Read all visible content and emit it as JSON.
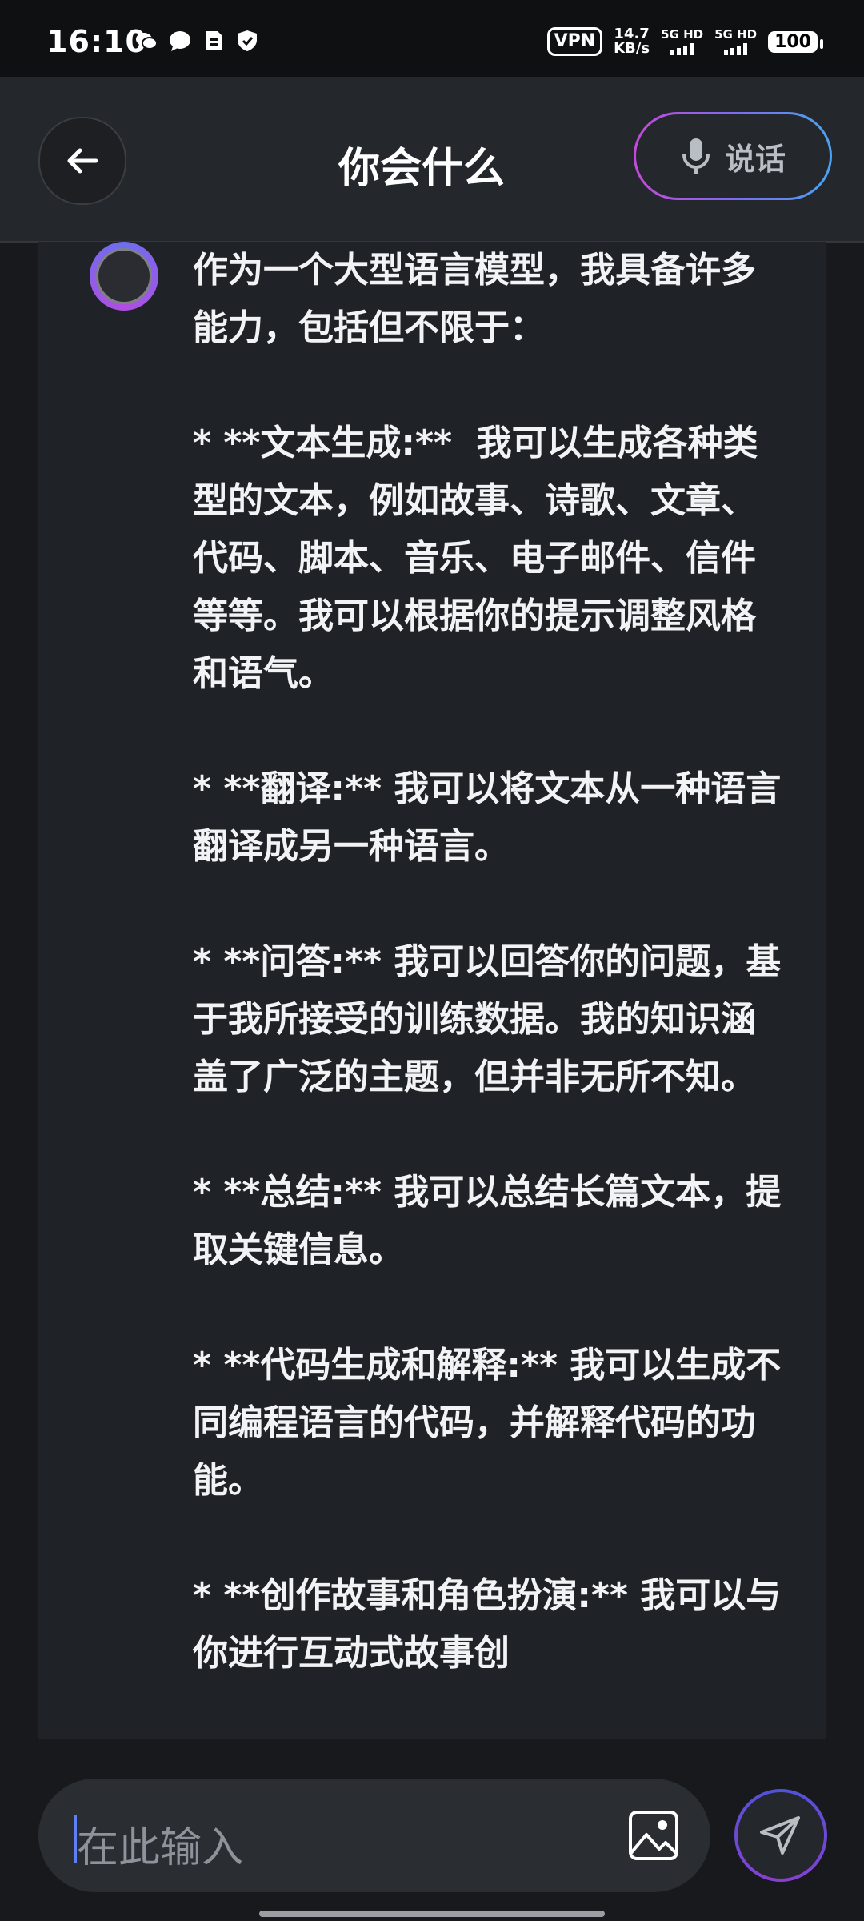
{
  "status_bar": {
    "time": "16:10",
    "icons": [
      "wechat-icon",
      "message-icon",
      "sim-icon",
      "shield-icon"
    ],
    "vpn": "VPN",
    "speed_value": "14.7",
    "speed_unit": "KB/s",
    "signal1": "5G HD",
    "signal2": "5G HD",
    "battery": "100"
  },
  "header": {
    "title": "你会什么",
    "talk_label": "说话"
  },
  "message": {
    "text": "作为一个大型语言模型，我具备许多能力，包括但不限于：\n\n* **文本生成:**  我可以生成各种类型的文本，例如故事、诗歌、文章、代码、脚本、音乐、电子邮件、信件等等。我可以根据你的提示调整风格和语气。\n\n* **翻译:** 我可以将文本从一种语言翻译成另一种语言。\n\n* **问答:** 我可以回答你的问题，基于我所接受的训练数据。我的知识涵盖了广泛的主题，但并非无所不知。\n\n* **总结:** 我可以总结长篇文本，提取关键信息。\n\n* **代码生成和解释:** 我可以生成不同编程语言的代码，并解释代码的功能。\n\n* **创作故事和角色扮演:** 我可以与你进行互动式故事创"
  },
  "input": {
    "placeholder": "在此输入"
  },
  "colors": {
    "accent_purple": "#b04ee0",
    "accent_blue": "#5e7ff5",
    "background": "#17191d"
  }
}
